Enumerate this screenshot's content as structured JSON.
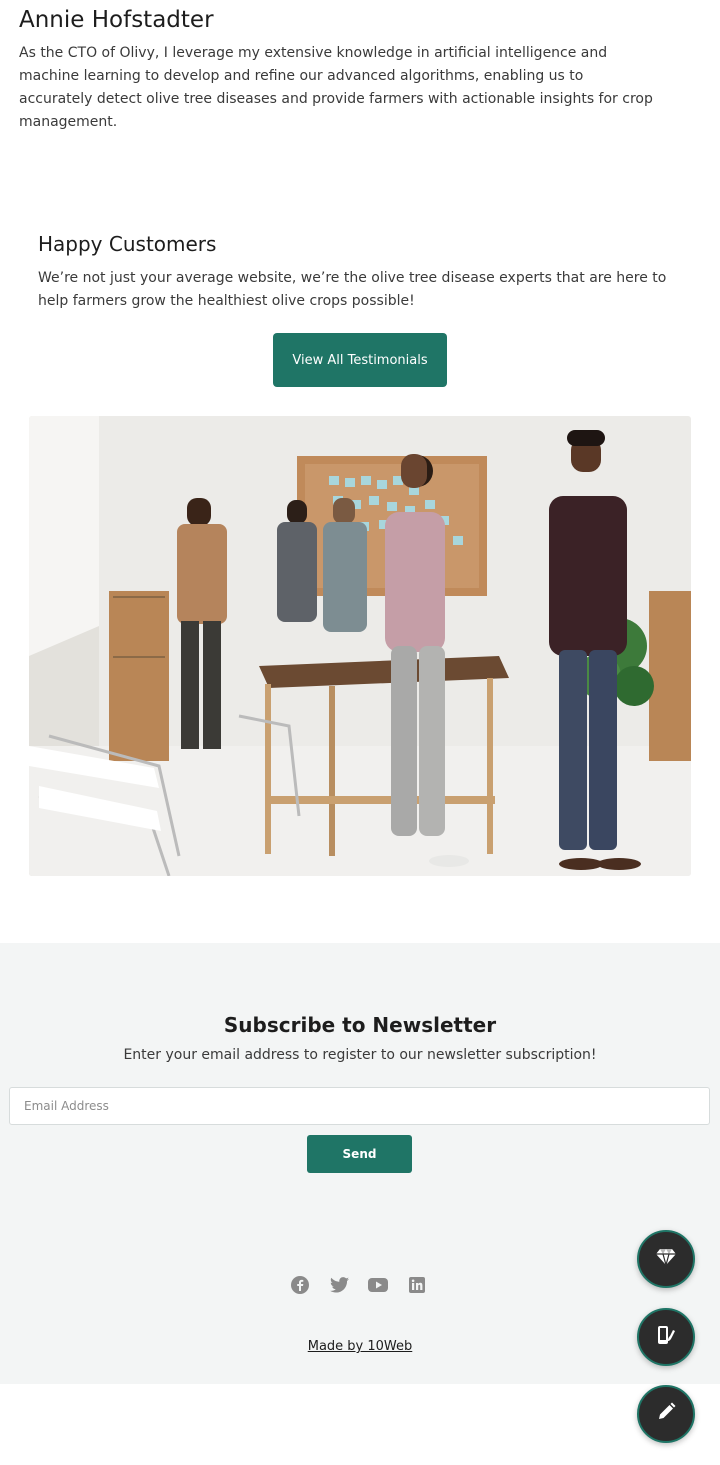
{
  "bio": {
    "name": "Annie Hofstadter",
    "text": "As the CTO of Olivy, I leverage my extensive knowledge in artificial intelligence and machine learning to develop and refine our advanced algorithms, enabling us to accurately detect olive tree diseases and provide farmers with actionable insights for crop management."
  },
  "happy": {
    "title": "Happy Customers",
    "text": "We’re not just your average website, we’re the olive tree disease experts that are here to help farmers grow the healthiest olive crops possible!",
    "button_label": "View All Testimonials"
  },
  "newsletter": {
    "title": "Subscribe to Newsletter",
    "subtitle": "Enter your email address to register  to  our newsletter subscription!",
    "email_placeholder": "Email Address",
    "send_label": "Send"
  },
  "socials": [
    "facebook-icon",
    "twitter-icon",
    "youtube-icon",
    "linkedin-icon"
  ],
  "footer": {
    "made_by": "Made by 10Web"
  },
  "fabs": [
    "diamond-icon",
    "phone-brush-icon",
    "pencil-icon"
  ],
  "colors": {
    "accent": "#1f7566",
    "fab_bg": "#2c2c2c",
    "newsletter_bg": "#f3f5f5"
  }
}
